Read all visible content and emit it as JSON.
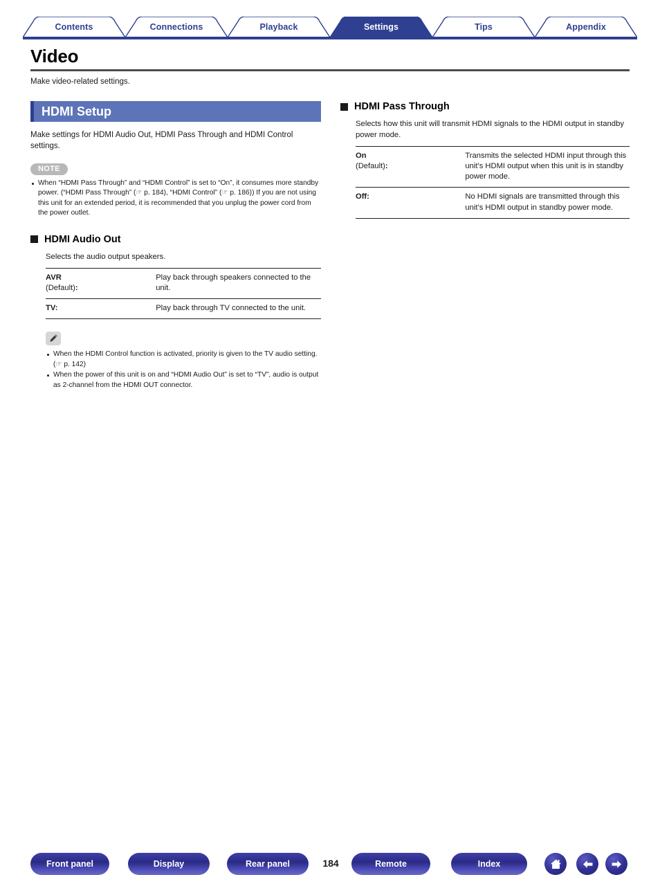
{
  "tabs": [
    {
      "label": "Contents",
      "active": false
    },
    {
      "label": "Connections",
      "active": false
    },
    {
      "label": "Playback",
      "active": false
    },
    {
      "label": "Settings",
      "active": true
    },
    {
      "label": "Tips",
      "active": false
    },
    {
      "label": "Appendix",
      "active": false
    }
  ],
  "page": {
    "title": "Video",
    "intro": "Make video-related settings."
  },
  "section": {
    "banner_title": "HDMI Setup",
    "description": "Make settings for HDMI Audio Out, HDMI Pass Through and HDMI Control settings.",
    "note": {
      "badge": "NOTE",
      "items": [
        "When “HDMI Pass Through” and “HDMI Control” is set to “On”, it consumes more standby power. (“HDMI Pass Through” (☞ p. 184), “HDMI Control” (☞ p. 186)) If you are not using this unit for an extended period, it is recommended that you unplug the power cord from the power outlet."
      ]
    }
  },
  "hdmi_audio_out": {
    "heading": "HDMI Audio Out",
    "description": "Selects the audio output speakers.",
    "rows": [
      {
        "key_main": "AVR",
        "key_sub": "(Default)",
        "key_colon": ":",
        "value": "Play back through speakers connected to the unit."
      },
      {
        "key_main": "TV",
        "key_sub": "",
        "key_colon": ":",
        "value": "Play back through TV connected to the unit."
      }
    ],
    "tips": [
      "When the HDMI Control function is activated, priority is given to the TV audio setting.  (☞ p. 142)",
      "When the power of this unit is on and “HDMI Audio Out” is set to “TV”, audio is output as 2-channel from the HDMI OUT connector."
    ]
  },
  "hdmi_pass_through": {
    "heading": "HDMI Pass Through",
    "description": "Selects how this unit will transmit HDMI signals to the HDMI output in standby power mode.",
    "rows": [
      {
        "key_main": "On",
        "key_sub": "(Default)",
        "key_colon": ":",
        "value": "Transmits the selected HDMI input through this unit’s HDMI output when this unit is in standby power mode."
      },
      {
        "key_main": "Off",
        "key_sub": "",
        "key_colon": ":",
        "value": "No HDMI signals are transmitted through this unit’s HDMI output in standby power mode."
      }
    ]
  },
  "footer": {
    "buttons": [
      {
        "label": "Front panel"
      },
      {
        "label": "Display"
      },
      {
        "label": "Rear panel"
      },
      {
        "label": "Remote"
      },
      {
        "label": "Index"
      }
    ],
    "page_number": "184",
    "icons": [
      {
        "name": "home-icon"
      },
      {
        "name": "arrow-left-icon"
      },
      {
        "name": "arrow-right-icon"
      }
    ]
  },
  "colors": {
    "navy": "#2f3f91",
    "banner_blue": "#5d74b8",
    "note_gray": "#b8b8b8",
    "rule_gray": "#4c4c4c"
  }
}
